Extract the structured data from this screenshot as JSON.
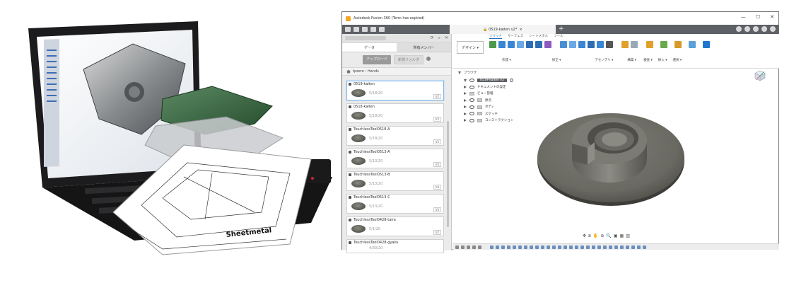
{
  "window": {
    "title": "Autodesk Fusion 360 (Term has expired)",
    "controls": [
      "—",
      "☐",
      "✕"
    ]
  },
  "document_tab": {
    "name": "0519-kaiten v2*"
  },
  "data_panel": {
    "tabs": [
      "データ",
      "所有メンバー"
    ],
    "upload_button": "アップロード",
    "new_folder_button": "新規フォルダ",
    "breadcrumb": [
      "tpzero",
      "Hands"
    ],
    "items": [
      {
        "name": "0519-kaiten",
        "date": "5/18/20",
        "version": "V2"
      },
      {
        "name": "0518-kaiten",
        "date": "5/18/20",
        "version": "V2"
      },
      {
        "name": "TouchlessTool0518-A",
        "date": "5/18/20",
        "version": "V2"
      },
      {
        "name": "TouchlessTool0513-A",
        "date": "5/13/20",
        "version": "V2"
      },
      {
        "name": "TouchlessTool0513-B",
        "date": "5/13/20",
        "version": "V4"
      },
      {
        "name": "TouchlessTool0513-C",
        "date": "5/13/20",
        "version": "V2"
      },
      {
        "name": "TouchlessTool0428-taira",
        "date": "5/1/20",
        "version": "V2"
      },
      {
        "name": "TouchlessTool0428-gyaku",
        "date": "4/30/20",
        "version": ""
      }
    ]
  },
  "ribbon": {
    "workspace_button": "デザイン ▾",
    "tabs": [
      "ソリッド",
      "サーフェス",
      "シートメタル",
      "ツール"
    ],
    "groups": [
      "作成 ▾",
      "修正 ▾",
      "アセンブリ ▾",
      "構築 ▾",
      "検査 ▾",
      "挿入 ▾",
      "選択 ▾"
    ]
  },
  "browser": {
    "header": "ブラウザ",
    "root": "0519-kaiten v2",
    "items": [
      "ドキュメントの設定",
      "ビュー管理",
      "原点",
      "ボディ",
      "スケッチ",
      "コンストラクション"
    ]
  },
  "colors": {
    "tabbar": "#5d6166",
    "accent": "#1e6fc2",
    "part": "#6f6e66"
  }
}
